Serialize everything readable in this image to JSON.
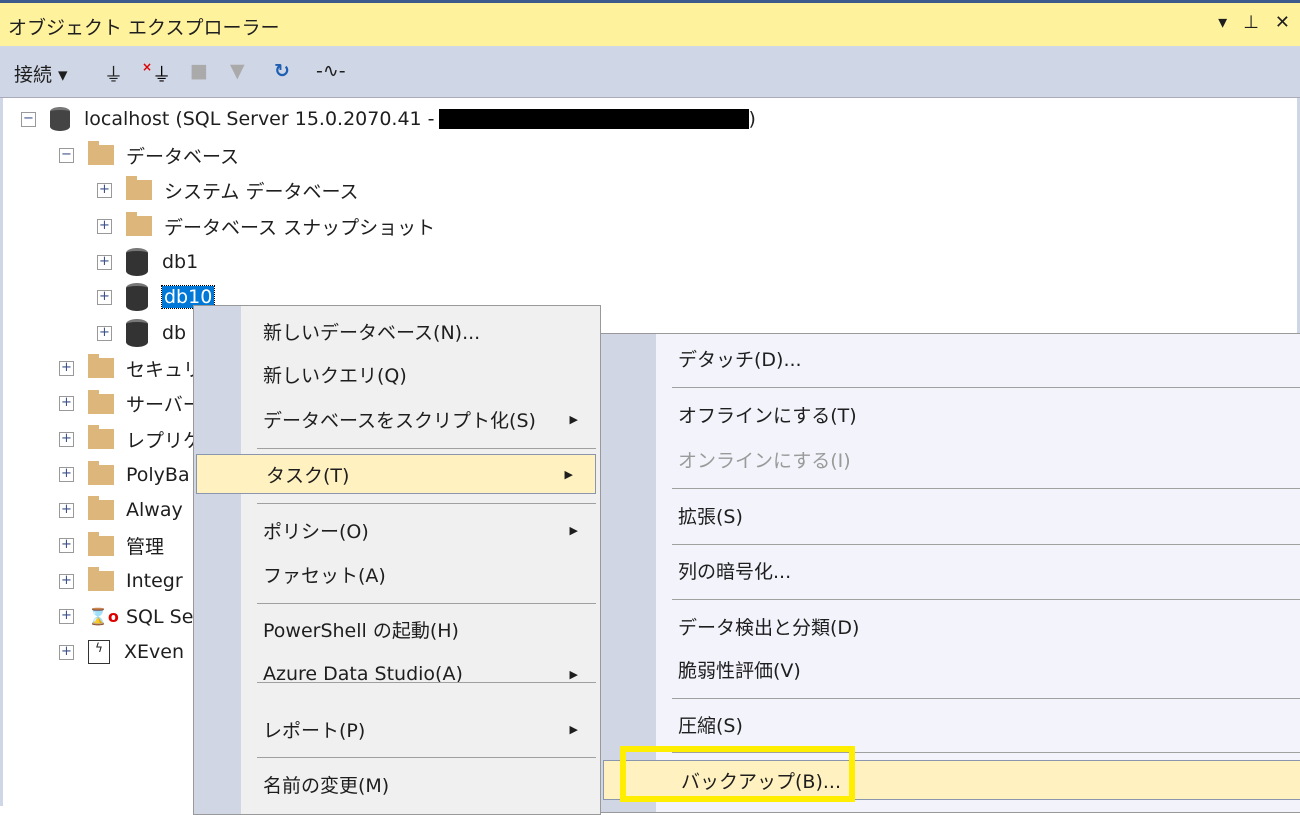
{
  "window": {
    "title": "オブジェクト エクスプローラー",
    "pin_icon": "pin-icon",
    "dropdown_icon": "dropdown-icon",
    "close_icon": "close-icon"
  },
  "toolbar": {
    "connect": "接続"
  },
  "tree": {
    "server": "localhost (SQL Server 15.0.2070.41 -",
    "server_end": ")",
    "databases": "データベース",
    "system_db": "システム データベース",
    "snapshots": "データベース スナップショット",
    "db1": "db1",
    "db10": "db10",
    "db_other": "db",
    "items": [
      "セキュリ",
      "サーバー",
      "レプリケ",
      "PolyBa",
      "Alway",
      "管理",
      "Integr",
      "SQL Se",
      "XEven"
    ]
  },
  "context_menu": [
    {
      "label": "新しいデータベース(N)..."
    },
    {
      "label": "新しいクエリ(Q)"
    },
    {
      "label": "データベースをスクリプト化(S)",
      "sub": true
    },
    {
      "label": "タスク(T)",
      "sub": true,
      "highlighted": true
    },
    {
      "label": "ポリシー(O)",
      "sub": true
    },
    {
      "label": "ファセット(A)"
    },
    {
      "label": "PowerShell の起動(H)"
    },
    {
      "label": "Azure Data Studio(A)",
      "sub": true
    },
    {
      "label": "レポート(P)",
      "sub": true
    },
    {
      "label": "名前の変更(M)"
    }
  ],
  "task_submenu": [
    {
      "label": "デタッチ(D)..."
    },
    {
      "label": "オフラインにする(T)"
    },
    {
      "label": "オンラインにする(I)",
      "disabled": true
    },
    {
      "label": "拡張(S)"
    },
    {
      "label": "列の暗号化..."
    },
    {
      "label": "データ検出と分類(D)"
    },
    {
      "label": "脆弱性評価(V)"
    },
    {
      "label": "圧縮(S)"
    },
    {
      "label": "バックアップ(B)...",
      "highlighted": true
    }
  ]
}
